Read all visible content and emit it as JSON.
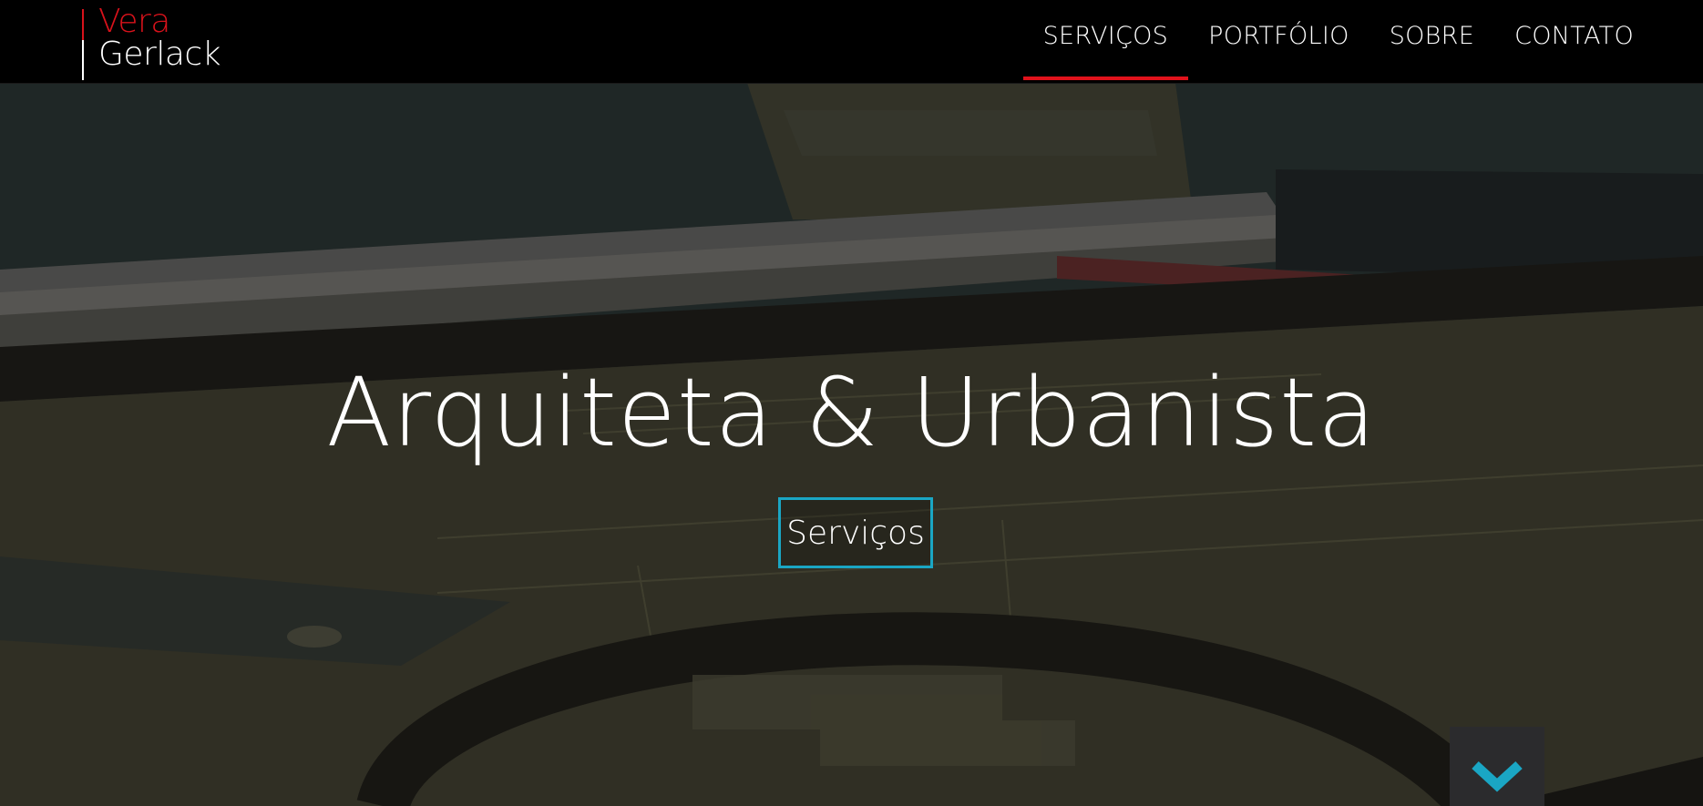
{
  "logo": {
    "first": "Vera",
    "last": "Gerlack"
  },
  "nav": {
    "items": [
      {
        "label": "SERVIÇOS",
        "active": true
      },
      {
        "label": "PORTFÓLIO",
        "active": false
      },
      {
        "label": "SOBRE",
        "active": false
      },
      {
        "label": "CONTATO",
        "active": false
      }
    ]
  },
  "hero": {
    "title": "Arquiteta & Urbanista",
    "button_label": "Serviços",
    "scroll_icon": "chevron-down-icon"
  },
  "colors": {
    "accent_red": "#e1121b",
    "accent_teal": "#1aa6c4",
    "nav_background": "#000000"
  }
}
